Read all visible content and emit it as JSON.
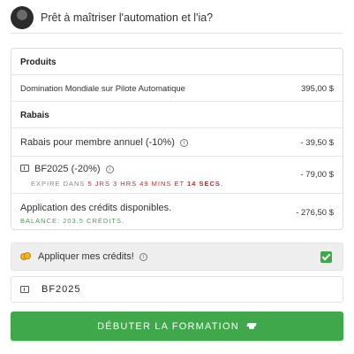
{
  "header": {
    "title": "Prêt à maîtriser l'automation et l'ia?"
  },
  "order": {
    "products_title": "Produits",
    "products": [
      {
        "name": "Domination Mondiale sur Pilote Automatique",
        "price": "395,00 $"
      }
    ],
    "discounts_title": "Rabais",
    "member_discount": {
      "name": "Rabais pour membre annuel (-10%)",
      "amount": "- 39,50 $",
      "icon": "info-icon"
    },
    "coupon_discount": {
      "name": "BF2025 (-20%)",
      "amount": "- 79,00 $",
      "icon": "ticket-icon",
      "expires_prefix": "EXPIRE DANS",
      "countdown_time": "5 JRS 3 HRS 49 MINS ET",
      "countdown_secs": "14 SECS",
      "expires_suffix": "."
    },
    "credits": {
      "name": "Application des crédits disponibles.",
      "amount": "- 276,50 $",
      "balance": "BALANCE: 203.5 CRÉDITS."
    }
  },
  "apply_credits": {
    "label": "Appliquer mes crédits!",
    "checked": true,
    "icon": "coins-icon"
  },
  "coupon_field": {
    "value": "BF2025",
    "icon": "ticket-icon"
  },
  "cta": {
    "label": "DÉBUTER LA FORMATION",
    "icon": "graduation-cap-icon",
    "color": "#3fa84a"
  },
  "colors": {
    "accent_green": "#3fa84a",
    "countdown_red": "#e02020"
  }
}
